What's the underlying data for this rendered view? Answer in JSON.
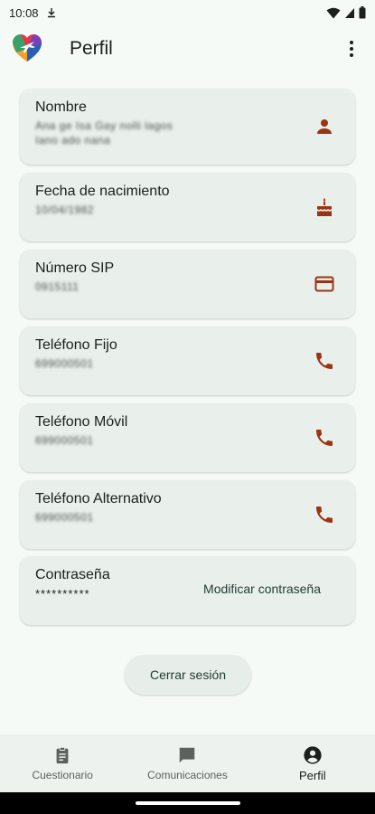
{
  "status": {
    "time": "10:08"
  },
  "app": {
    "title": "Perfil"
  },
  "fields": [
    {
      "label": "Nombre",
      "value_line1": "Ana ge Isa Gay nolli lagos",
      "value_line2": "Iano ado nana",
      "icon": "person-icon"
    },
    {
      "label": "Fecha de nacimiento",
      "value_line1": "10/04/1982",
      "icon": "cake-icon"
    },
    {
      "label": "Número SIP",
      "value_line1": "0915111",
      "icon": "credit-card-icon"
    },
    {
      "label": "Teléfono Fijo",
      "value_line1": "699000501",
      "icon": "phone-icon"
    },
    {
      "label": "Teléfono Móvil",
      "value_line1": "699000501",
      "icon": "phone-icon"
    },
    {
      "label": "Teléfono Alternativo",
      "value_line1": "699000501",
      "icon": "phone-icon"
    }
  ],
  "password": {
    "label": "Contraseña",
    "value": "**********",
    "action": "Modificar contraseña"
  },
  "logout_label": "Cerrar sesión",
  "nav": [
    {
      "label": "Cuestionario",
      "icon": "clipboard-icon"
    },
    {
      "label": "Comunicaciones",
      "icon": "chat-icon"
    },
    {
      "label": "Perfil",
      "icon": "account-circle-icon",
      "active": true
    }
  ],
  "colors": {
    "accent": "#9a3412",
    "card": "#e9efeb",
    "background": "#f6faf7"
  }
}
